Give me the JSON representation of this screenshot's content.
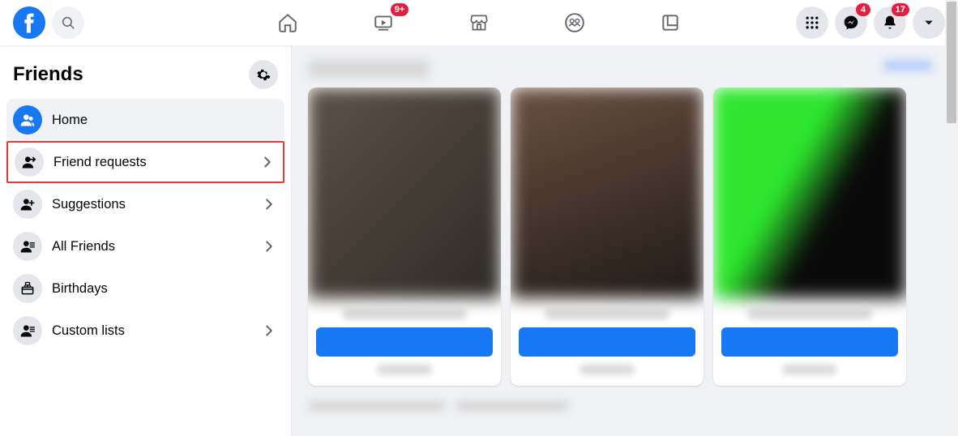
{
  "topbar": {
    "watch_badge": "9+",
    "messenger_badge": "4",
    "notifications_badge": "17"
  },
  "sidebar": {
    "title": "Friends",
    "items": [
      {
        "label": "Home"
      },
      {
        "label": "Friend requests"
      },
      {
        "label": "Suggestions"
      },
      {
        "label": "All Friends"
      },
      {
        "label": "Birthdays"
      },
      {
        "label": "Custom lists"
      }
    ]
  }
}
